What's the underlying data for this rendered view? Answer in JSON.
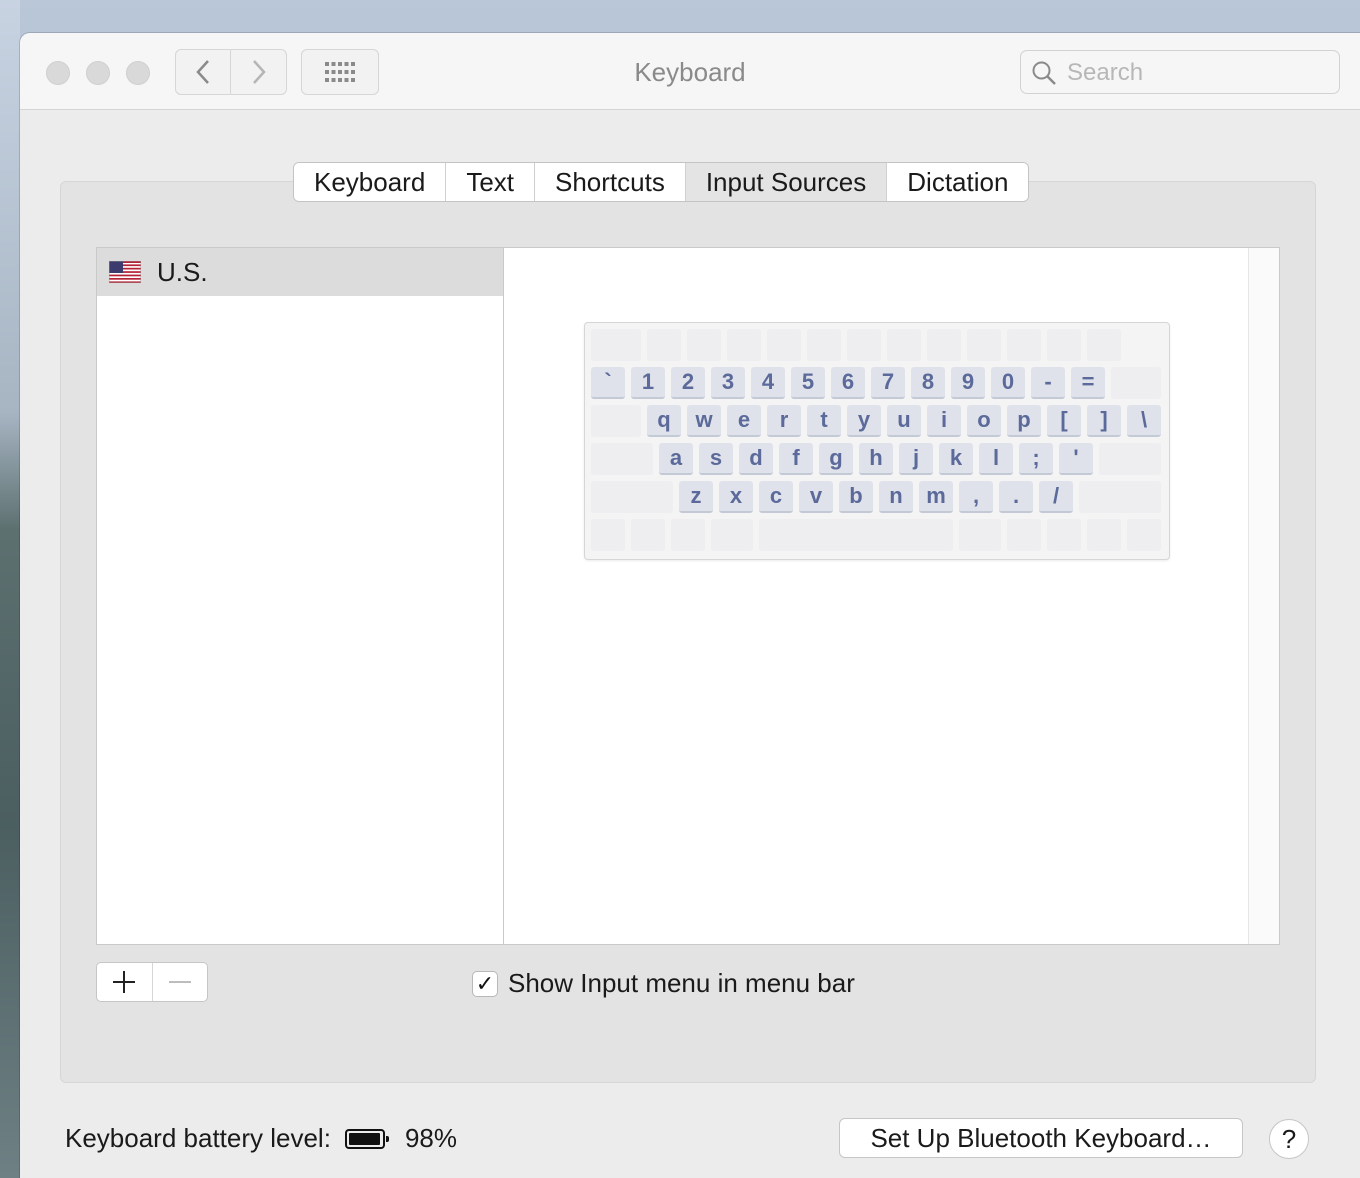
{
  "window": {
    "title": "Keyboard"
  },
  "search": {
    "placeholder": "Search",
    "icon": "search-icon"
  },
  "tabs": [
    {
      "label": "Keyboard",
      "active": false
    },
    {
      "label": "Text",
      "active": false
    },
    {
      "label": "Shortcuts",
      "active": false
    },
    {
      "label": "Input Sources",
      "active": true
    },
    {
      "label": "Dictation",
      "active": false
    }
  ],
  "input_sources": {
    "items": [
      {
        "label": "U.S.",
        "icon": "us-flag-icon",
        "selected": true
      }
    ]
  },
  "keyboard_preview": {
    "rows": [
      [
        "`",
        "1",
        "2",
        "3",
        "4",
        "5",
        "6",
        "7",
        "8",
        "9",
        "0",
        "-",
        "="
      ],
      [
        "q",
        "w",
        "e",
        "r",
        "t",
        "y",
        "u",
        "i",
        "o",
        "p",
        "[",
        "]",
        "\\"
      ],
      [
        "a",
        "s",
        "d",
        "f",
        "g",
        "h",
        "j",
        "k",
        "l",
        ";",
        "'"
      ],
      [
        "z",
        "x",
        "c",
        "v",
        "b",
        "n",
        "m",
        ",",
        ".",
        "/"
      ]
    ]
  },
  "list_controls": {
    "add_icon": "plus-icon",
    "remove_icon": "minus-icon"
  },
  "show_input_menu": {
    "label": "Show Input menu in menu bar",
    "checked": true
  },
  "battery": {
    "label": "Keyboard battery level:",
    "percent": "98%",
    "level": 0.98
  },
  "buttons": {
    "setup_bluetooth": "Set Up Bluetooth Keyboard…",
    "help": "?"
  },
  "colors": {
    "key_text": "#5b6a9a",
    "active_tab": "#e4e4e4"
  }
}
